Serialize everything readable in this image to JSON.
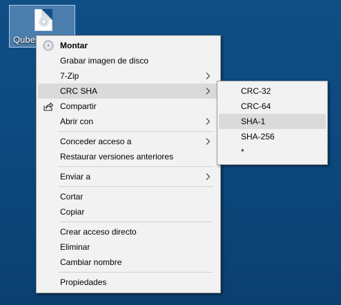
{
  "desktop": {
    "file_label": "Qubes"
  },
  "main_menu": {
    "items": [
      {
        "label": "Montar",
        "bold": true,
        "icon": "disc-image-icon"
      },
      {
        "label": "Grabar imagen de disco"
      },
      {
        "label": "7-Zip",
        "submenu": true
      },
      {
        "label": "CRC SHA",
        "submenu": true,
        "highlighted": true
      },
      {
        "label": "Compartir",
        "icon": "share-icon"
      },
      {
        "label": "Abrir con",
        "submenu": true
      },
      {
        "label": "Conceder acceso a",
        "submenu": true
      },
      {
        "label": "Restaurar versiones anteriores"
      },
      {
        "label": "Enviar a",
        "submenu": true
      },
      {
        "label": "Cortar"
      },
      {
        "label": "Copiar"
      },
      {
        "label": "Crear acceso directo"
      },
      {
        "label": "Eliminar"
      },
      {
        "label": "Cambiar nombre"
      },
      {
        "label": "Propiedades"
      }
    ]
  },
  "sub_menu": {
    "items": [
      {
        "label": "CRC-32"
      },
      {
        "label": "CRC-64"
      },
      {
        "label": "SHA-1",
        "highlighted": true
      },
      {
        "label": "SHA-256"
      },
      {
        "label": "*"
      }
    ]
  },
  "colors": {
    "desktop_bg": "#0f4f86",
    "menu_bg": "#f2f2f2",
    "highlight": "#dadada"
  }
}
